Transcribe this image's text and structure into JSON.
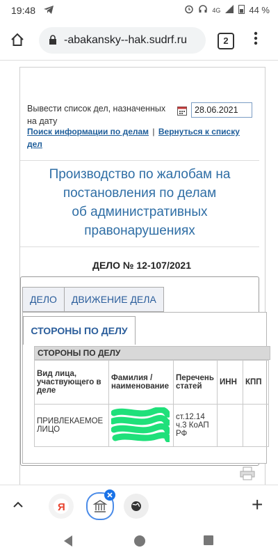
{
  "status": {
    "time": "19:48",
    "network": "4G",
    "battery": "44 %"
  },
  "browser": {
    "url": "-abakansky--hak.sudrf.ru",
    "tab_count": "2"
  },
  "date_filter": {
    "label": "Вывести список дел, назначенных на дату",
    "value": "28.06.2021"
  },
  "links": {
    "search": "Поиск информации по делам",
    "separator": "|",
    "back": "Вернуться к списку дел"
  },
  "heading": {
    "line1": "Производство по жалобам на",
    "line2": "постановления по делам",
    "line3": "об административных",
    "line4": "правонарушениях"
  },
  "case_number": "ДЕЛО № 12-107/2021",
  "tabs": [
    {
      "label": "ДЕЛО"
    },
    {
      "label": "ДВИЖЕНИЕ ДЕЛА"
    }
  ],
  "subtab": {
    "label": "СТОРОНЫ ПО ДЕЛУ"
  },
  "table": {
    "caption": "СТОРОНЫ ПО ДЕЛУ",
    "headers": [
      "Вид лица, участвующего в деле",
      "Фамилия / наименование",
      "Перечень статей",
      "ИНН",
      "КПП"
    ],
    "row": {
      "kind": "ПРИВЛЕКАЕМОЕ ЛИЦО",
      "name": "",
      "articles": "ст.12.14 ч.3 КоАП РФ",
      "inn": "",
      "kpp": ""
    }
  },
  "colors": {
    "link": "#1f5e9a",
    "heading": "#2f6ea5",
    "redaction": "#1fe07a",
    "yandex": "#e8432f"
  },
  "icons": [
    "home-icon",
    "lock-icon",
    "menu-icon",
    "calendar-icon",
    "printer-icon",
    "chevron-up-icon",
    "plus-icon",
    "back-icon",
    "home-nav-icon",
    "recents-icon"
  ]
}
